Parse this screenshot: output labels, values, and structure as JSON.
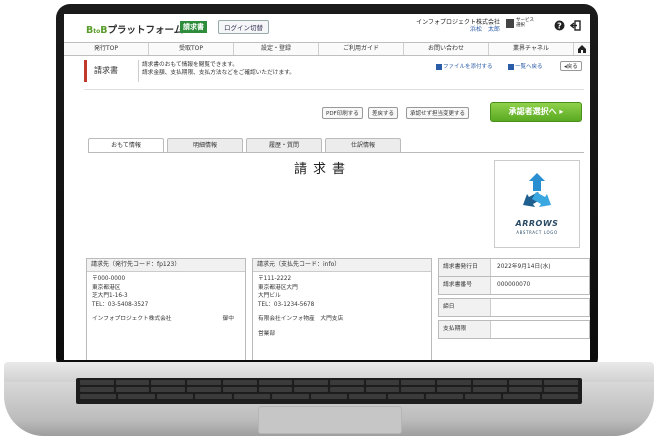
{
  "header": {
    "logo_prefix": "B",
    "logo_mid": "to",
    "logo_b2": "B",
    "logo_text": "プラットフォーム",
    "logo_tag": "請求書",
    "login_button": "ログイン切替",
    "company_name": "インフォプロジェクト株式会社",
    "user_name": "浜松　太郎",
    "service_line1": "サービス",
    "service_line2": "選択"
  },
  "nav": {
    "items": [
      "発行TOP",
      "受取TOP",
      "設定・登録",
      "ご利用ガイド",
      "お問い合わせ",
      "業界チャネル"
    ]
  },
  "page": {
    "heading": "請求書",
    "desc_line1": "請求書のおもて情報を閲覧できます。",
    "desc_line2": "請求金額、支払期限、支払方法などをご確認いただけます。",
    "link_file": "ファイルを添付する",
    "link_list": "一覧へ戻る",
    "back_button": "戻る",
    "btn_pdf": "PDF印刷する",
    "btn_reject": "差戻する",
    "btn_forward": "承認せず担当変更する",
    "btn_approve": "承認者選択へ"
  },
  "tabs": [
    "おもて情報",
    "明細情報",
    "履歴・質問",
    "仕訳情報"
  ],
  "document": {
    "title": "請求書",
    "logo_name": "ARROWS",
    "logo_sub": "ABSTRACT LOGO"
  },
  "billing_to": {
    "header": "請求先（発行先コード：fp123）",
    "lines": [
      "〒000-0000",
      "東京都港区",
      "芝大門1-16-3",
      "TEL：03-5408-3527"
    ],
    "company": "インフォプロジェクト株式会社",
    "honorific": "御中"
  },
  "billing_from": {
    "header": "請求元（支払先コード：info）",
    "lines": [
      "〒111-2222",
      "東京都港区大門",
      "大門ビル",
      "TEL：03-1234-5678"
    ],
    "company": "有限会社インフォ物産　大門支店",
    "dept": "営業部"
  },
  "info_rows": [
    {
      "key": "請求書発行日",
      "value": "2022年9月14日(水)"
    },
    {
      "key": "請求書番号",
      "value": "000000070"
    },
    {
      "key": "締日",
      "value": ""
    },
    {
      "key": "支払期限",
      "value": ""
    }
  ],
  "colors": {
    "brand_green": "#2d8d3a",
    "approve_green": "#5aa922",
    "link_blue": "#2b5ca8",
    "heading_accent": "#c0392b",
    "logo_blue": "#2a8fd0"
  },
  "icons": {
    "help": "question-circle-icon",
    "logout": "logout-icon",
    "home": "home-icon",
    "attach": "attach-file-icon",
    "list": "list-icon",
    "back": "back-arrow-icon"
  }
}
